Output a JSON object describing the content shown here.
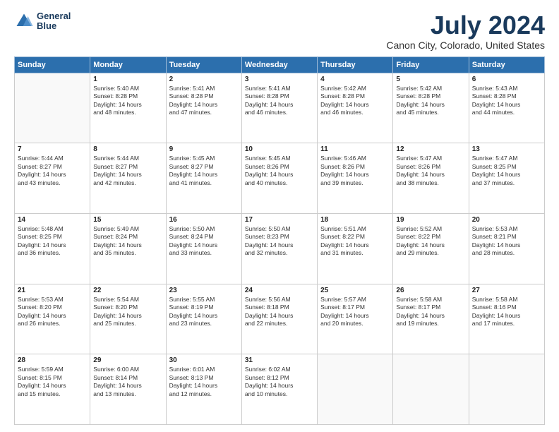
{
  "header": {
    "logo_line1": "General",
    "logo_line2": "Blue",
    "title": "July 2024",
    "subtitle": "Canon City, Colorado, United States"
  },
  "weekdays": [
    "Sunday",
    "Monday",
    "Tuesday",
    "Wednesday",
    "Thursday",
    "Friday",
    "Saturday"
  ],
  "weeks": [
    [
      {
        "day": "",
        "info": ""
      },
      {
        "day": "1",
        "info": "Sunrise: 5:40 AM\nSunset: 8:28 PM\nDaylight: 14 hours\nand 48 minutes."
      },
      {
        "day": "2",
        "info": "Sunrise: 5:41 AM\nSunset: 8:28 PM\nDaylight: 14 hours\nand 47 minutes."
      },
      {
        "day": "3",
        "info": "Sunrise: 5:41 AM\nSunset: 8:28 PM\nDaylight: 14 hours\nand 46 minutes."
      },
      {
        "day": "4",
        "info": "Sunrise: 5:42 AM\nSunset: 8:28 PM\nDaylight: 14 hours\nand 46 minutes."
      },
      {
        "day": "5",
        "info": "Sunrise: 5:42 AM\nSunset: 8:28 PM\nDaylight: 14 hours\nand 45 minutes."
      },
      {
        "day": "6",
        "info": "Sunrise: 5:43 AM\nSunset: 8:28 PM\nDaylight: 14 hours\nand 44 minutes."
      }
    ],
    [
      {
        "day": "7",
        "info": "Sunrise: 5:44 AM\nSunset: 8:27 PM\nDaylight: 14 hours\nand 43 minutes."
      },
      {
        "day": "8",
        "info": "Sunrise: 5:44 AM\nSunset: 8:27 PM\nDaylight: 14 hours\nand 42 minutes."
      },
      {
        "day": "9",
        "info": "Sunrise: 5:45 AM\nSunset: 8:27 PM\nDaylight: 14 hours\nand 41 minutes."
      },
      {
        "day": "10",
        "info": "Sunrise: 5:45 AM\nSunset: 8:26 PM\nDaylight: 14 hours\nand 40 minutes."
      },
      {
        "day": "11",
        "info": "Sunrise: 5:46 AM\nSunset: 8:26 PM\nDaylight: 14 hours\nand 39 minutes."
      },
      {
        "day": "12",
        "info": "Sunrise: 5:47 AM\nSunset: 8:26 PM\nDaylight: 14 hours\nand 38 minutes."
      },
      {
        "day": "13",
        "info": "Sunrise: 5:47 AM\nSunset: 8:25 PM\nDaylight: 14 hours\nand 37 minutes."
      }
    ],
    [
      {
        "day": "14",
        "info": "Sunrise: 5:48 AM\nSunset: 8:25 PM\nDaylight: 14 hours\nand 36 minutes."
      },
      {
        "day": "15",
        "info": "Sunrise: 5:49 AM\nSunset: 8:24 PM\nDaylight: 14 hours\nand 35 minutes."
      },
      {
        "day": "16",
        "info": "Sunrise: 5:50 AM\nSunset: 8:24 PM\nDaylight: 14 hours\nand 33 minutes."
      },
      {
        "day": "17",
        "info": "Sunrise: 5:50 AM\nSunset: 8:23 PM\nDaylight: 14 hours\nand 32 minutes."
      },
      {
        "day": "18",
        "info": "Sunrise: 5:51 AM\nSunset: 8:22 PM\nDaylight: 14 hours\nand 31 minutes."
      },
      {
        "day": "19",
        "info": "Sunrise: 5:52 AM\nSunset: 8:22 PM\nDaylight: 14 hours\nand 29 minutes."
      },
      {
        "day": "20",
        "info": "Sunrise: 5:53 AM\nSunset: 8:21 PM\nDaylight: 14 hours\nand 28 minutes."
      }
    ],
    [
      {
        "day": "21",
        "info": "Sunrise: 5:53 AM\nSunset: 8:20 PM\nDaylight: 14 hours\nand 26 minutes."
      },
      {
        "day": "22",
        "info": "Sunrise: 5:54 AM\nSunset: 8:20 PM\nDaylight: 14 hours\nand 25 minutes."
      },
      {
        "day": "23",
        "info": "Sunrise: 5:55 AM\nSunset: 8:19 PM\nDaylight: 14 hours\nand 23 minutes."
      },
      {
        "day": "24",
        "info": "Sunrise: 5:56 AM\nSunset: 8:18 PM\nDaylight: 14 hours\nand 22 minutes."
      },
      {
        "day": "25",
        "info": "Sunrise: 5:57 AM\nSunset: 8:17 PM\nDaylight: 14 hours\nand 20 minutes."
      },
      {
        "day": "26",
        "info": "Sunrise: 5:58 AM\nSunset: 8:17 PM\nDaylight: 14 hours\nand 19 minutes."
      },
      {
        "day": "27",
        "info": "Sunrise: 5:58 AM\nSunset: 8:16 PM\nDaylight: 14 hours\nand 17 minutes."
      }
    ],
    [
      {
        "day": "28",
        "info": "Sunrise: 5:59 AM\nSunset: 8:15 PM\nDaylight: 14 hours\nand 15 minutes."
      },
      {
        "day": "29",
        "info": "Sunrise: 6:00 AM\nSunset: 8:14 PM\nDaylight: 14 hours\nand 13 minutes."
      },
      {
        "day": "30",
        "info": "Sunrise: 6:01 AM\nSunset: 8:13 PM\nDaylight: 14 hours\nand 12 minutes."
      },
      {
        "day": "31",
        "info": "Sunrise: 6:02 AM\nSunset: 8:12 PM\nDaylight: 14 hours\nand 10 minutes."
      },
      {
        "day": "",
        "info": ""
      },
      {
        "day": "",
        "info": ""
      },
      {
        "day": "",
        "info": ""
      }
    ]
  ]
}
